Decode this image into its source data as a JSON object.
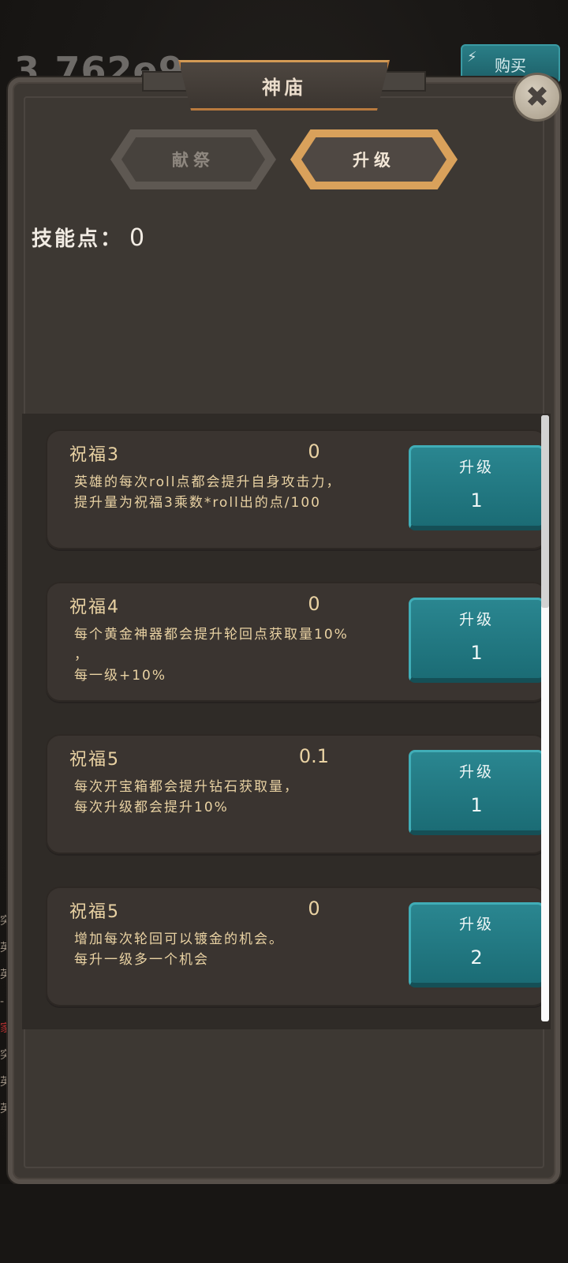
{
  "background": {
    "counter": "3,762e9",
    "buy_label": "购买",
    "side_text": [
      "突",
      "英",
      "英",
      "-",
      "家",
      "突",
      "英",
      "英"
    ]
  },
  "panel": {
    "title": "神庙",
    "close_icon": "close-icon",
    "tabs": [
      {
        "label": "献祭",
        "active": false
      },
      {
        "label": "升级",
        "active": true
      }
    ],
    "skill_points_label": "技能点：",
    "skill_points_value": "0"
  },
  "blessings": [
    {
      "name": "祝福3",
      "value": "0",
      "desc": "英雄的每次roll点都会提升自身攻击力，\n提升量为祝福3乘数*roll出的点/100",
      "button_label": "升级",
      "cost": "1"
    },
    {
      "name": "祝福4",
      "value": "0",
      "desc": "每个黄金神器都会提升轮回点获取量10%\n，\n每一级+10%",
      "button_label": "升级",
      "cost": "1"
    },
    {
      "name": "祝福5",
      "value": "0.1",
      "desc": "每次开宝箱都会提升钻石获取量，\n每次升级都会提升10%",
      "button_label": "升级",
      "cost": "1"
    },
    {
      "name": "祝福5",
      "value": "0",
      "desc": "增加每次轮回可以镀金的机会。\n每升一级多一个机会",
      "button_label": "升级",
      "cost": "2"
    }
  ],
  "colors": {
    "accent_gold": "#d9a15b",
    "button_teal": "#1f7780",
    "text_gold": "#e9d2a3",
    "panel_bg": "#3d3833"
  }
}
